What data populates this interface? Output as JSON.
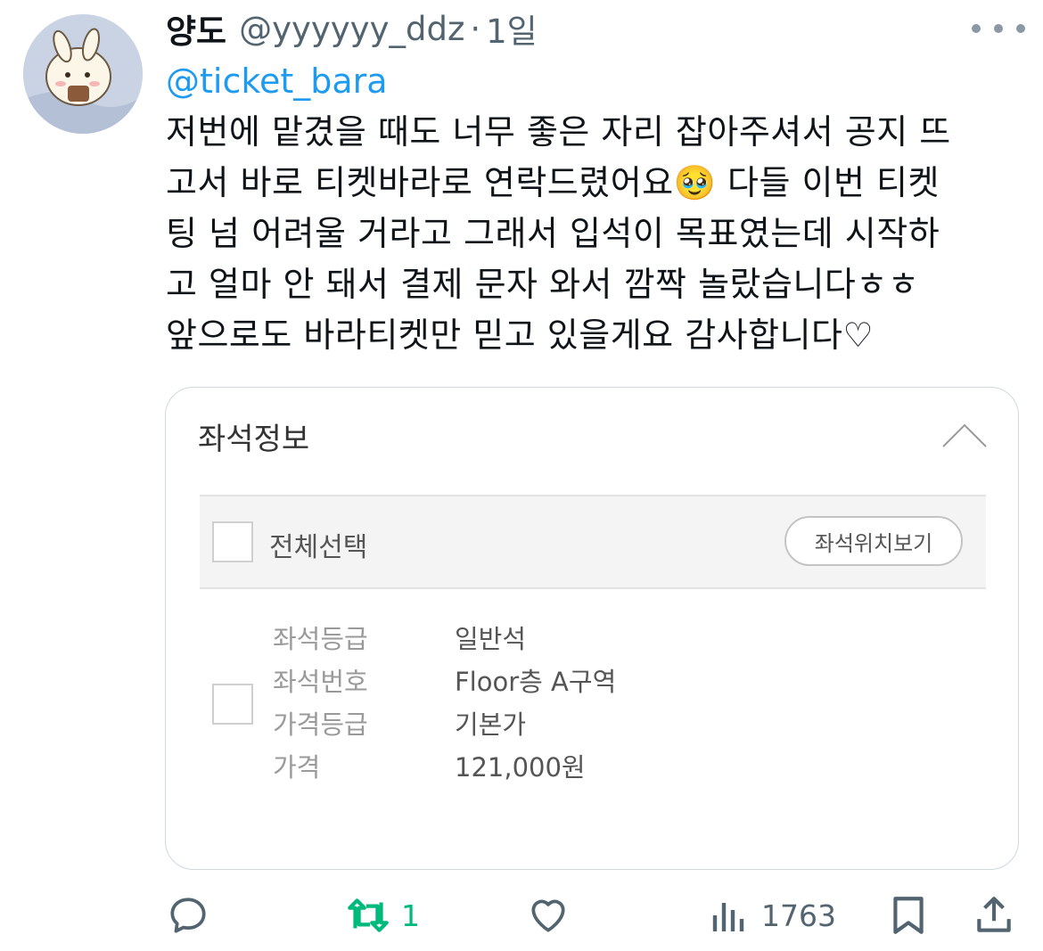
{
  "tweet": {
    "author_name": "양도",
    "handle": "@yyyyyy_ddz",
    "separator": "·",
    "time": "1일",
    "mention": "@ticket_bara",
    "lines": [
      "저번에 맡겼을 때도 너무 좋은 자리 잡아주셔서 공지 뜨",
      "고서 바로 티켓바라로 연락드렸어요",
      " 다들 이번 티켓",
      "팅 넘 어려울 거라고 그래서 입석이 목표였는데 시작하",
      "고 얼마 안 돼서 결제 문자 와서 깜짝 놀랐습니다ㅎㅎ",
      "앞으로도 바라티켓만 믿고 있을게요 감사합니다♡"
    ],
    "emoji": "🥹"
  },
  "card": {
    "title": "좌석정보",
    "select_all_label": "전체선택",
    "seat_map_button": "좌석위치보기",
    "rows": [
      {
        "label": "좌석등급",
        "value": "일반석"
      },
      {
        "label": "좌석번호",
        "value": "Floor층 A구역"
      },
      {
        "label": "가격등급",
        "value": "기본가"
      },
      {
        "label": "가격",
        "value": "121,000원"
      }
    ]
  },
  "actions": {
    "retweet_count": "1",
    "views_count": "1763"
  },
  "colors": {
    "link": "#1d9bf0",
    "retweet_active": "#00ba7c",
    "secondary_text": "#536471"
  }
}
